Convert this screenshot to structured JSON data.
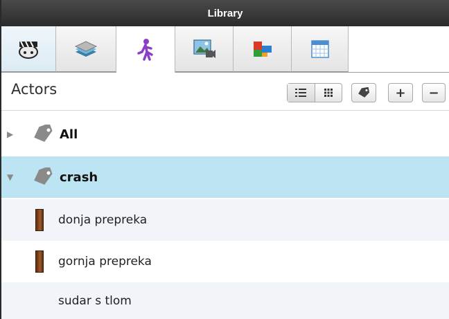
{
  "window": {
    "title": "Library"
  },
  "tabs": [
    {
      "name": "game-center-icon",
      "active": false
    },
    {
      "name": "scenes-layers-icon",
      "active": false
    },
    {
      "name": "actors-figure-icon",
      "active": true
    },
    {
      "name": "media-icon",
      "active": false
    },
    {
      "name": "tiles-icon",
      "active": false
    },
    {
      "name": "tables-icon",
      "active": false
    }
  ],
  "toolbar": {
    "section_title": "Actors",
    "add_label": "+",
    "remove_label": "−"
  },
  "tree": {
    "groups": [
      {
        "label": "All",
        "expanded": false
      },
      {
        "label": "crash",
        "expanded": true
      }
    ],
    "items": [
      {
        "label": "donja prepreka"
      },
      {
        "label": "gornja prepreka"
      },
      {
        "label": "sudar s tlom"
      }
    ]
  },
  "colors": {
    "selected_row": "#bde4f2",
    "titlebar": "#2b2b2b",
    "alt_row": "#f1f4f8"
  }
}
